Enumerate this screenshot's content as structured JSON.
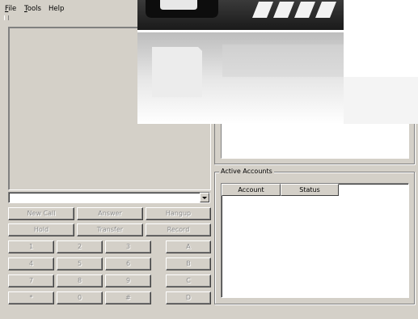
{
  "menu": {
    "file": {
      "mnemonic": "F",
      "rest": "ile"
    },
    "tools": {
      "mnemonic": "T",
      "rest": "ools"
    },
    "help": {
      "label": "Help"
    }
  },
  "call_controls": {
    "new_call": "New Call",
    "answer": "Answer",
    "hangup": "Hangup",
    "hold": "Hold",
    "transfer": "Transfer",
    "record": "Record"
  },
  "dialpad": {
    "keys": [
      "1",
      "2",
      "3",
      "A",
      "4",
      "5",
      "6",
      "B",
      "7",
      "8",
      "9",
      "C",
      "*",
      "0",
      "#",
      "D"
    ]
  },
  "accounts": {
    "title": "Active Accounts",
    "columns": [
      "Account",
      "Status"
    ]
  }
}
